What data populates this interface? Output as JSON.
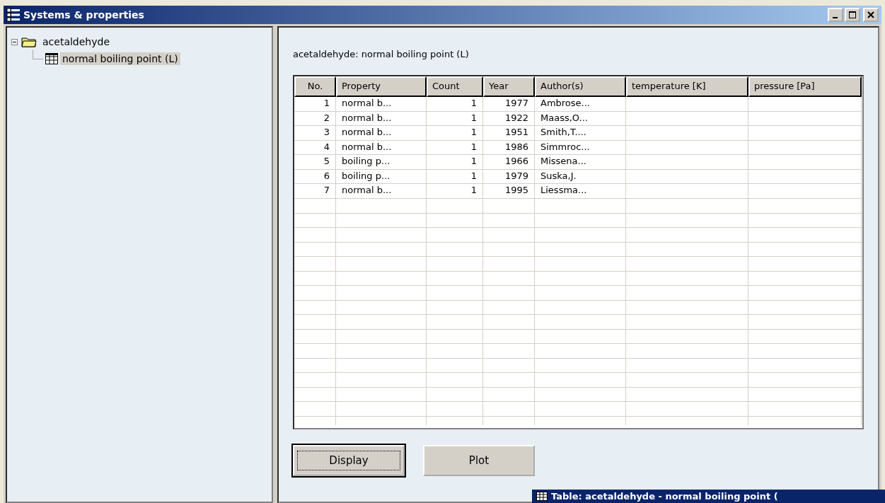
{
  "window": {
    "title": "Systems & properties"
  },
  "tree": [
    {
      "label": "acetaldehyde",
      "expanded": true,
      "selected": false,
      "children": [
        {
          "label": "normal boiling point (L)",
          "selected": true
        }
      ]
    }
  ],
  "heading": "acetaldehyde: normal boiling point (L)",
  "table": {
    "columns": [
      "No.",
      "Property",
      "Count",
      "Year",
      "Author(s)",
      "temperature [K]",
      "pressure  [Pa]"
    ],
    "rows": [
      [
        "1",
        "normal b...",
        "1",
        "1977",
        "Ambrose..."
      ],
      [
        "2",
        "normal b...",
        "1",
        "1922",
        "Maass,O..."
      ],
      [
        "3",
        "normal b...",
        "1",
        "1951",
        "Smith,T...."
      ],
      [
        "4",
        "normal b...",
        "1",
        "1986",
        "Simmroc..."
      ],
      [
        "5",
        "boiling p...",
        "1",
        "1966",
        "Missena..."
      ],
      [
        "6",
        "boiling p...",
        "1",
        "1979",
        "Suska,J."
      ],
      [
        "7",
        "normal b...",
        "1",
        "1995",
        "Liessma..."
      ]
    ]
  },
  "buttons": [
    {
      "label": "Display",
      "focused": true
    },
    {
      "label": "Plot",
      "focused": false
    }
  ],
  "second_window": {
    "title": "Table: acetaldehyde - normal boiling point ("
  }
}
